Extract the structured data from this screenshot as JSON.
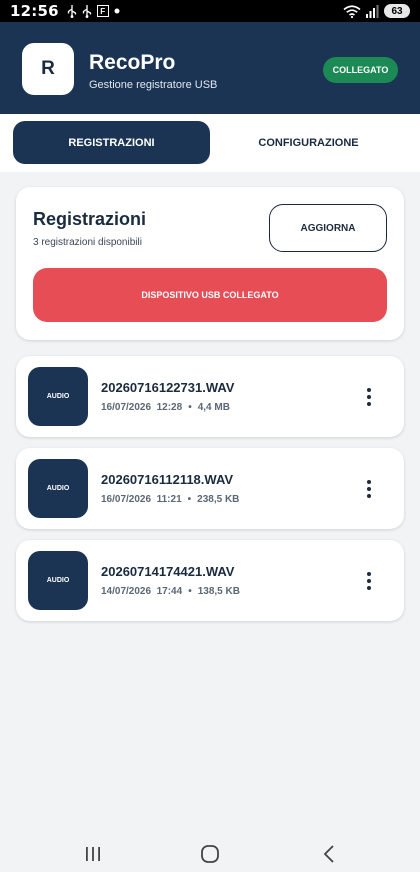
{
  "status_bar": {
    "time": "12:56",
    "box_glyph": "F",
    "battery": "63",
    "icons": [
      "usb-icon",
      "usb-icon",
      "notification-box-icon",
      "dot-icon",
      "wifi-icon",
      "signal-icon",
      "battery-icon"
    ]
  },
  "header": {
    "logo_letter": "R",
    "title": "RecoPro",
    "subtitle": "Gestione registratore USB",
    "status_badge": "COLLEGATO",
    "colors": {
      "header": "#1b3454",
      "badge": "#1c8a55"
    }
  },
  "tabs": [
    {
      "label": "REGISTRAZIONI",
      "active": true
    },
    {
      "label": "CONFIGURAZIONE",
      "active": false
    }
  ],
  "summary": {
    "title": "Registrazioni",
    "subtitle": "3 registrazioni disponibili",
    "refresh_label": "AGGIORNA",
    "usb_banner": "DISPOSITIVO USB COLLEGATO",
    "banner_color": "#e64d55"
  },
  "recordings": [
    {
      "thumb_label": "AUDIO",
      "name": "20260716122731.WAV",
      "date": "16/07/2026  12:28",
      "sep": "•",
      "size": "4,4 MB"
    },
    {
      "thumb_label": "AUDIO",
      "name": "20260716112118.WAV",
      "date": "16/07/2026  11:21",
      "sep": "•",
      "size": "238,5 KB"
    },
    {
      "thumb_label": "AUDIO",
      "name": "20260714174421.WAV",
      "date": "14/07/2026  17:44",
      "sep": "•",
      "size": "138,5 KB"
    }
  ],
  "nav_bar": {
    "icons": [
      "recents-icon",
      "home-icon",
      "back-icon"
    ]
  }
}
